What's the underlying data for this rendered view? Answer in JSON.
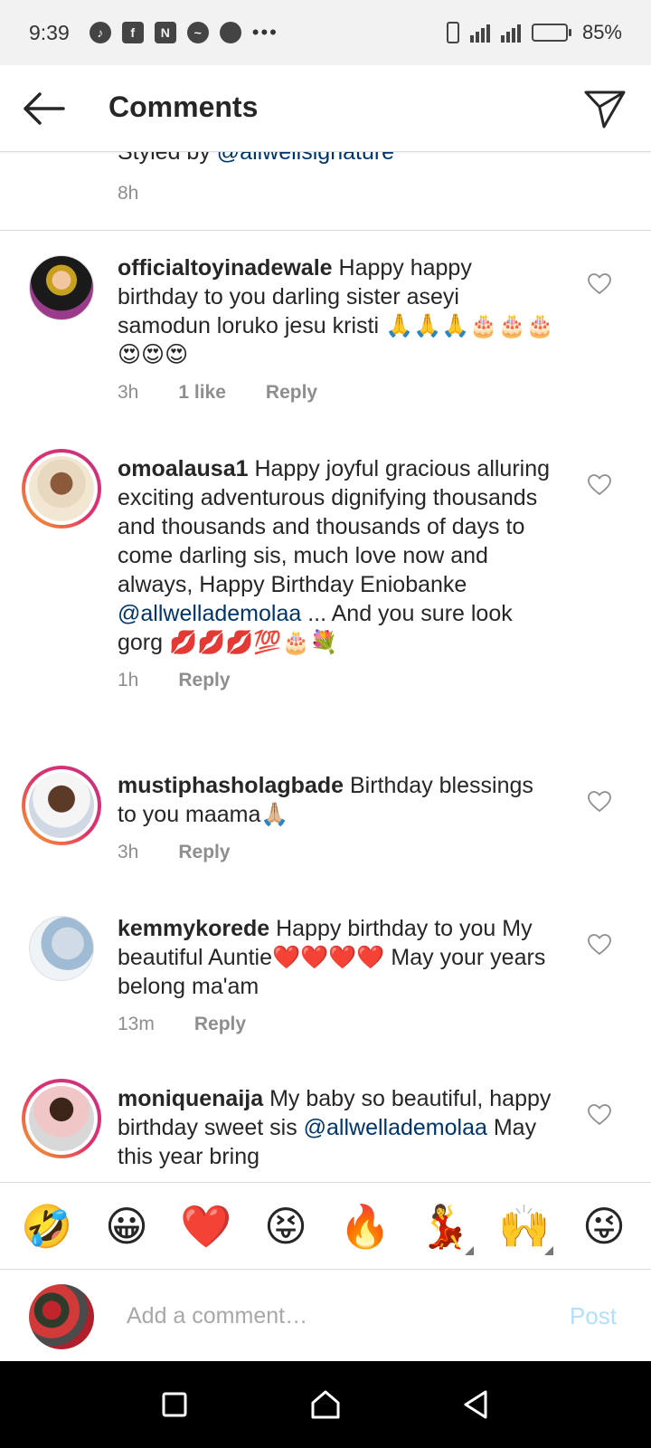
{
  "status_bar": {
    "time": "9:39",
    "notification_icons": [
      "music-icon",
      "facebook-icon",
      "news-icon",
      "messenger-icon",
      "circle-icon"
    ],
    "more": "•••",
    "battery": "85%",
    "battery_level": 0.85
  },
  "header": {
    "title": "Comments"
  },
  "caption": {
    "text_prefix": "Styled by ",
    "mention": "@allwellsignature",
    "time": "8h"
  },
  "comments": [
    {
      "username": "officialtoyinadewale",
      "text": " Happy happy birthday to you darling sister aseyi samodun loruko jesu kristi 🙏🙏🙏🎂🎂🎂😍😍😍",
      "time": "3h",
      "likes": "1 like",
      "reply": "Reply"
    },
    {
      "username": "omoalausa1",
      "text": " Happy joyful gracious alluring exciting adventurous dignifying thousands and thousands and thousands of days to come darling sis, much love now and always,  Happy Birthday Eniobanke ",
      "mention": "@allwellademolaa",
      "text_after": " ... And you sure look gorg 💋💋💋💯🎂💐",
      "time": "1h",
      "reply": "Reply"
    },
    {
      "username": "mustiphasholagbade",
      "text": " Birthday blessings to you maama🙏🏼",
      "time": "3h",
      "reply": "Reply"
    },
    {
      "username": "kemmykorede",
      "text": " Happy birthday to you My beautiful Auntie❤️❤️❤️❤️ May your years belong ma'am",
      "time": "13m",
      "reply": "Reply"
    },
    {
      "username": "moniquenaija",
      "text": " My baby so beautiful,  happy birthday sweet sis ",
      "mention": "@allwellademolaa",
      "text_after": " May this year bring"
    }
  ],
  "emoji_bar": [
    "🤣",
    "😀",
    "❤️",
    "😝",
    "🔥",
    "💃",
    "🙌",
    "😜"
  ],
  "input": {
    "placeholder": "Add a comment…",
    "post_label": "Post"
  },
  "colors": {
    "accent_link": "#003569",
    "post_disabled": "#b2dffc",
    "meta_gray": "#8e8e8e"
  }
}
